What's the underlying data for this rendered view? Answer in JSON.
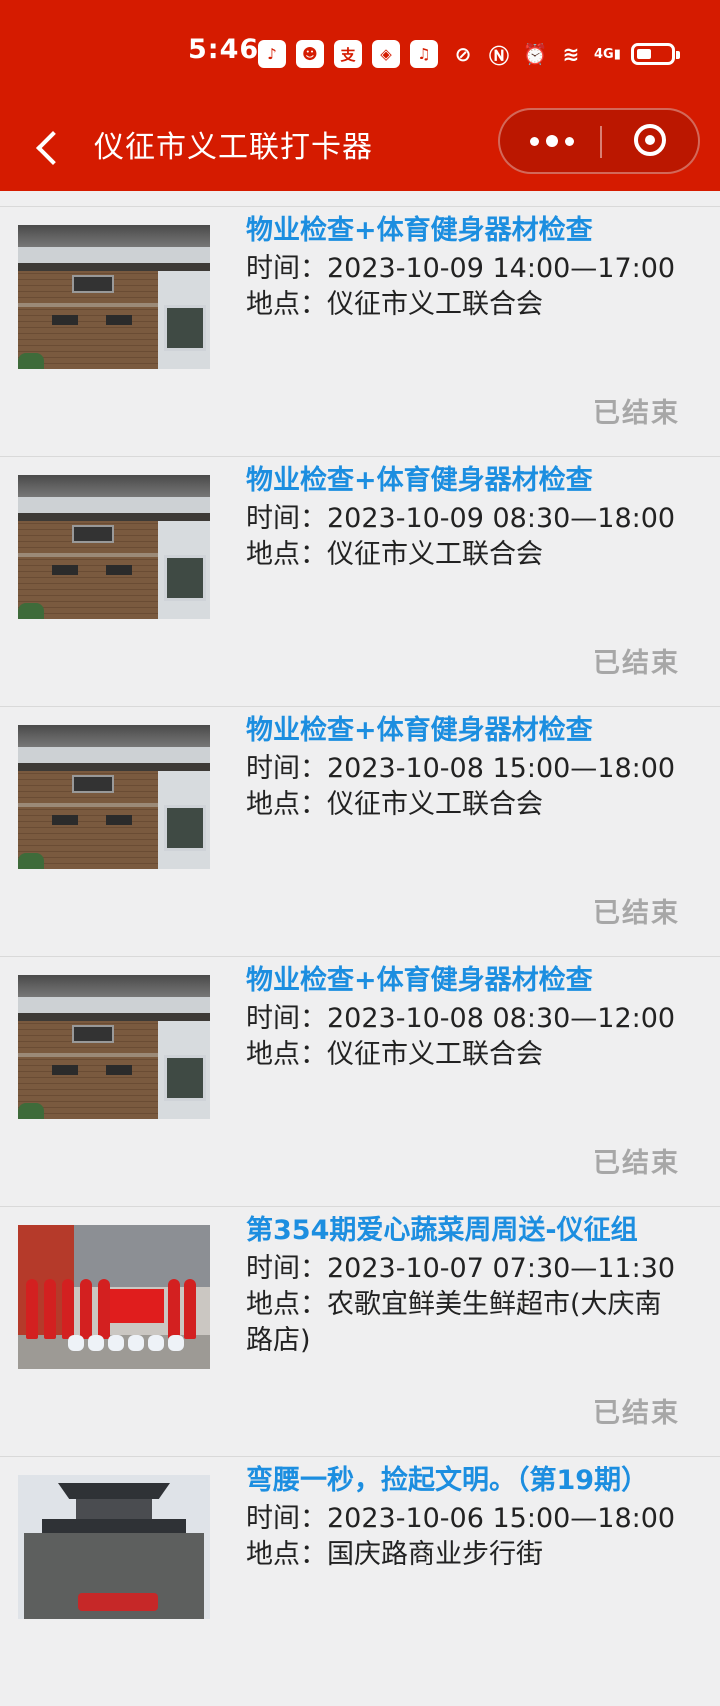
{
  "status_bar": {
    "time": "5:46",
    "app_icons": [
      "tiktok-icon",
      "qq-icon",
      "alipay-icon",
      "app-icon",
      "music-icon"
    ],
    "system_icons": [
      "mute-icon",
      "nfc-icon",
      "alarm-icon",
      "wifi-icon",
      "signal-4g-icon",
      "battery-icon"
    ],
    "network_label": "4G"
  },
  "navbar": {
    "title": "仪征市义工联打卡器"
  },
  "events": [
    {
      "title": "物业检查+体育健身器材检查",
      "time_label": "时间：",
      "time": "2023-10-09 14:00—17:00",
      "place_label": "地点：",
      "place": "仪征市义工联合会",
      "status": "已结束",
      "photo": "building-photo"
    },
    {
      "title": "物业检查+体育健身器材检查",
      "time_label": "时间：",
      "time": "2023-10-09 08:30—18:00",
      "place_label": "地点：",
      "place": "仪征市义工联合会",
      "status": "已结束",
      "photo": "building-photo"
    },
    {
      "title": "物业检查+体育健身器材检查",
      "time_label": "时间：",
      "time": "2023-10-08 15:00—18:00",
      "place_label": "地点：",
      "place": "仪征市义工联合会",
      "status": "已结束",
      "photo": "building-photo"
    },
    {
      "title": "物业检查+体育健身器材检查",
      "time_label": "时间：",
      "time": "2023-10-08 08:30—12:00",
      "place_label": "地点：",
      "place": "仪征市义工联合会",
      "status": "已结束",
      "photo": "building-photo"
    },
    {
      "title": "第354期爱心蔬菜周周送-仪征组",
      "time_label": "时间：",
      "time": "2023-10-07 07:30—11:30",
      "place_label": "地点：",
      "place": "农歌宜鲜美生鲜超市(大庆南路店)",
      "status": "已结束",
      "photo": "group-photo"
    },
    {
      "title": "弯腰一秒，捡起文明。（第19期）",
      "time_label": "时间：",
      "time": "2023-10-06 15:00—18:00",
      "place_label": "地点：",
      "place": "国庆路商业步行街",
      "status": "",
      "photo": "tower-photo"
    }
  ],
  "colors": {
    "header_bg": "#d51b00",
    "title_blue": "#1c8ee0",
    "status_grey": "#a7a7a7",
    "page_bg": "#efeff0"
  }
}
